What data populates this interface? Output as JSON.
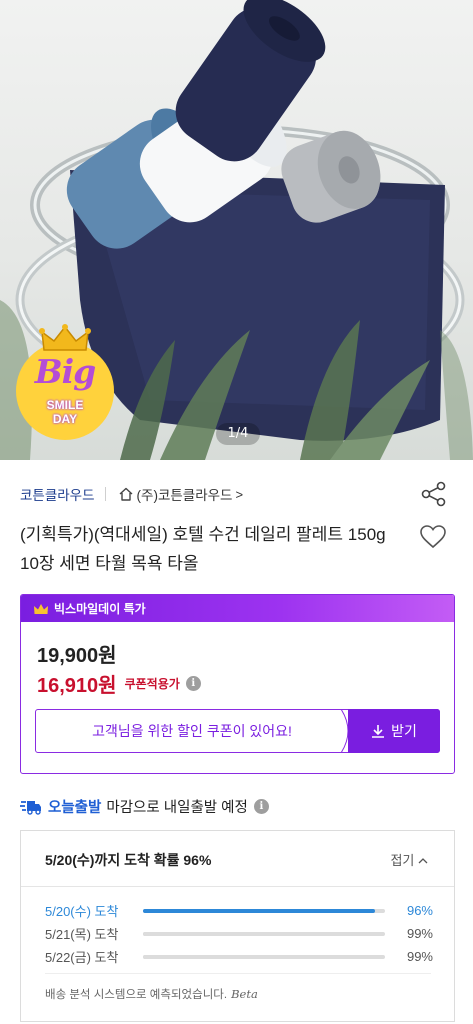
{
  "hero": {
    "page_indicator": "1/4",
    "badge": {
      "line1": "Big",
      "line2": "SMILE",
      "line3": "DAY"
    }
  },
  "seller": {
    "brand": "코튼클라우드",
    "store": "(주)코튼클라우드",
    "store_chevron": ">"
  },
  "product": {
    "title": "(기획특가)(역대세일) 호텔 수건 데일리 팔레트 150g 10장 세면 타월 목욕 타올"
  },
  "promo": {
    "header": "빅스마일데이 특가",
    "original_price": "19,900원",
    "sale_price": "16,910원",
    "coupon_applied_label": "쿠폰적용가",
    "coupon_message": "고객님을 위한 할인 쿠폰이 있어요!",
    "coupon_button": "받기"
  },
  "delivery": {
    "today_label": "오늘출발",
    "text": "마감으로 내일출발 예정",
    "probability_title": "5/20(수)까지 도착 확률 96%",
    "collapse_label": "접기",
    "rows": [
      {
        "label": "5/20(수) 도착",
        "percent": "96%",
        "value": 0.96
      },
      {
        "label": "5/21(목) 도착",
        "percent": "99%",
        "value": 0.99
      },
      {
        "label": "5/22(금) 도착",
        "percent": "99%",
        "value": 0.99
      }
    ],
    "footer": "배송 분석 시스템으로 예측되었습니다.",
    "beta": "Beta"
  },
  "colors": {
    "accent_purple": "#7a1ee0",
    "sale_red": "#c8102e",
    "delivery_blue": "#1f5fd4",
    "bar_blue": "#2d88d8"
  },
  "icons": [
    "share-icon",
    "home-icon",
    "heart-icon",
    "crown-icon",
    "info-icon",
    "download-icon",
    "truck-icon",
    "chevron-up-icon"
  ]
}
